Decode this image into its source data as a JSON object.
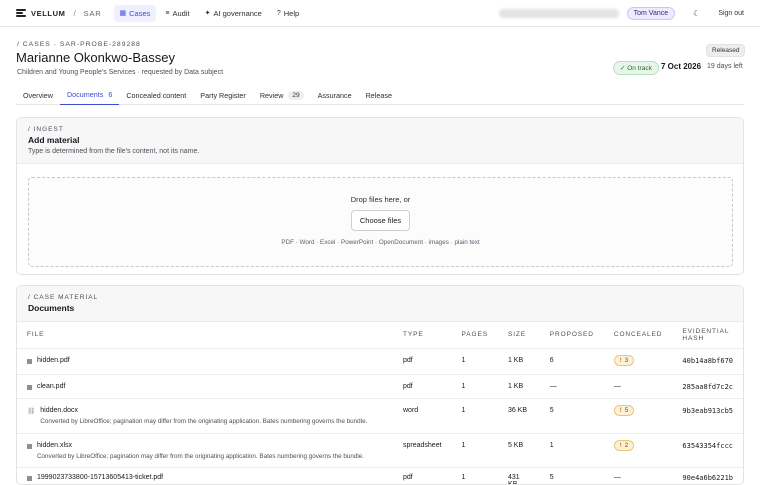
{
  "app": {
    "name": "VELLUM",
    "section": "SAR"
  },
  "nav": [
    {
      "label": "Cases",
      "icon": "cases-icon",
      "active": true
    },
    {
      "label": "Audit",
      "icon": "audit-icon",
      "active": false
    },
    {
      "label": "AI governance",
      "icon": "sparkle-icon",
      "active": false
    },
    {
      "label": "Help",
      "icon": "help-icon",
      "active": false
    }
  ],
  "user": {
    "name": "Tom Vance",
    "sign_out": "Sign out"
  },
  "case": {
    "breadcrumb": "/ CASES · SAR-PROBE-289288",
    "name": "Marianne Okonkwo-Bassey",
    "subtitle": "Children and Young People's Services · requested by Data subject",
    "state_badge": "Released",
    "track_status": "✓ On track",
    "due_date": "7 Oct 2026",
    "days_left": "19 days left"
  },
  "tabs": [
    {
      "label": "Overview",
      "count": "",
      "active": false
    },
    {
      "label": "Documents",
      "count": "6",
      "active": true
    },
    {
      "label": "Concealed content",
      "count": "",
      "active": false
    },
    {
      "label": "Party Register",
      "count": "",
      "active": false
    },
    {
      "label": "Review",
      "count": "29",
      "active": false
    },
    {
      "label": "Assurance",
      "count": "",
      "active": false
    },
    {
      "label": "Release",
      "count": "",
      "active": false
    }
  ],
  "ingest": {
    "eyebrow": "/ INGEST",
    "title": "Add material",
    "description": "Type is determined from the file's content, not its name.",
    "drop_text": "Drop files here, or",
    "choose_label": "Choose files",
    "formats": "PDF · Word · Excel · PowerPoint · OpenDocument · images · plain text"
  },
  "material": {
    "eyebrow": "/ CASE MATERIAL",
    "title": "Documents",
    "columns": {
      "file": "FILE",
      "type": "TYPE",
      "pages": "PAGES",
      "size": "SIZE",
      "proposed": "PROPOSED",
      "concealed": "CONCEALED",
      "hash": "EVIDENTIAL HASH"
    },
    "rows": [
      {
        "name": "hidden.pdf",
        "note": "",
        "type": "pdf",
        "pages": "1",
        "size": "1 KB",
        "proposed": "6",
        "concealed": "3",
        "hash": "40b14a8bf670",
        "icon": "file-icon"
      },
      {
        "name": "clean.pdf",
        "note": "",
        "type": "pdf",
        "pages": "1",
        "size": "1 KB",
        "proposed": "—",
        "concealed": "—",
        "hash": "285aa8fd7c2c",
        "icon": "file-icon"
      },
      {
        "name": "hidden.docx",
        "note": "Converted by LibreOffice; pagination may differ from the originating application. Bates numbering governs the bundle.",
        "type": "word",
        "pages": "1",
        "size": "36 KB",
        "proposed": "5",
        "concealed": "5",
        "hash": "9b3eab913cb5",
        "icon": "link-icon"
      },
      {
        "name": "hidden.xlsx",
        "note": "Converted by LibreOffice; pagination may differ from the originating application. Bates numbering governs the bundle.",
        "type": "spreadsheet",
        "pages": "1",
        "size": "5 KB",
        "proposed": "1",
        "concealed": "2",
        "hash": "63543354fccc",
        "icon": "file-icon"
      },
      {
        "name": "1999023733800-15713605413-ticket.pdf",
        "note": "",
        "type": "pdf",
        "pages": "1",
        "size": "431 KB",
        "proposed": "5",
        "concealed": "—",
        "hash": "90e4a6b6221b",
        "icon": "file-icon"
      }
    ]
  },
  "colors": {
    "accent": "#3b4bd8",
    "warning_bg": "#fdf0d5",
    "success": "#226b33"
  }
}
